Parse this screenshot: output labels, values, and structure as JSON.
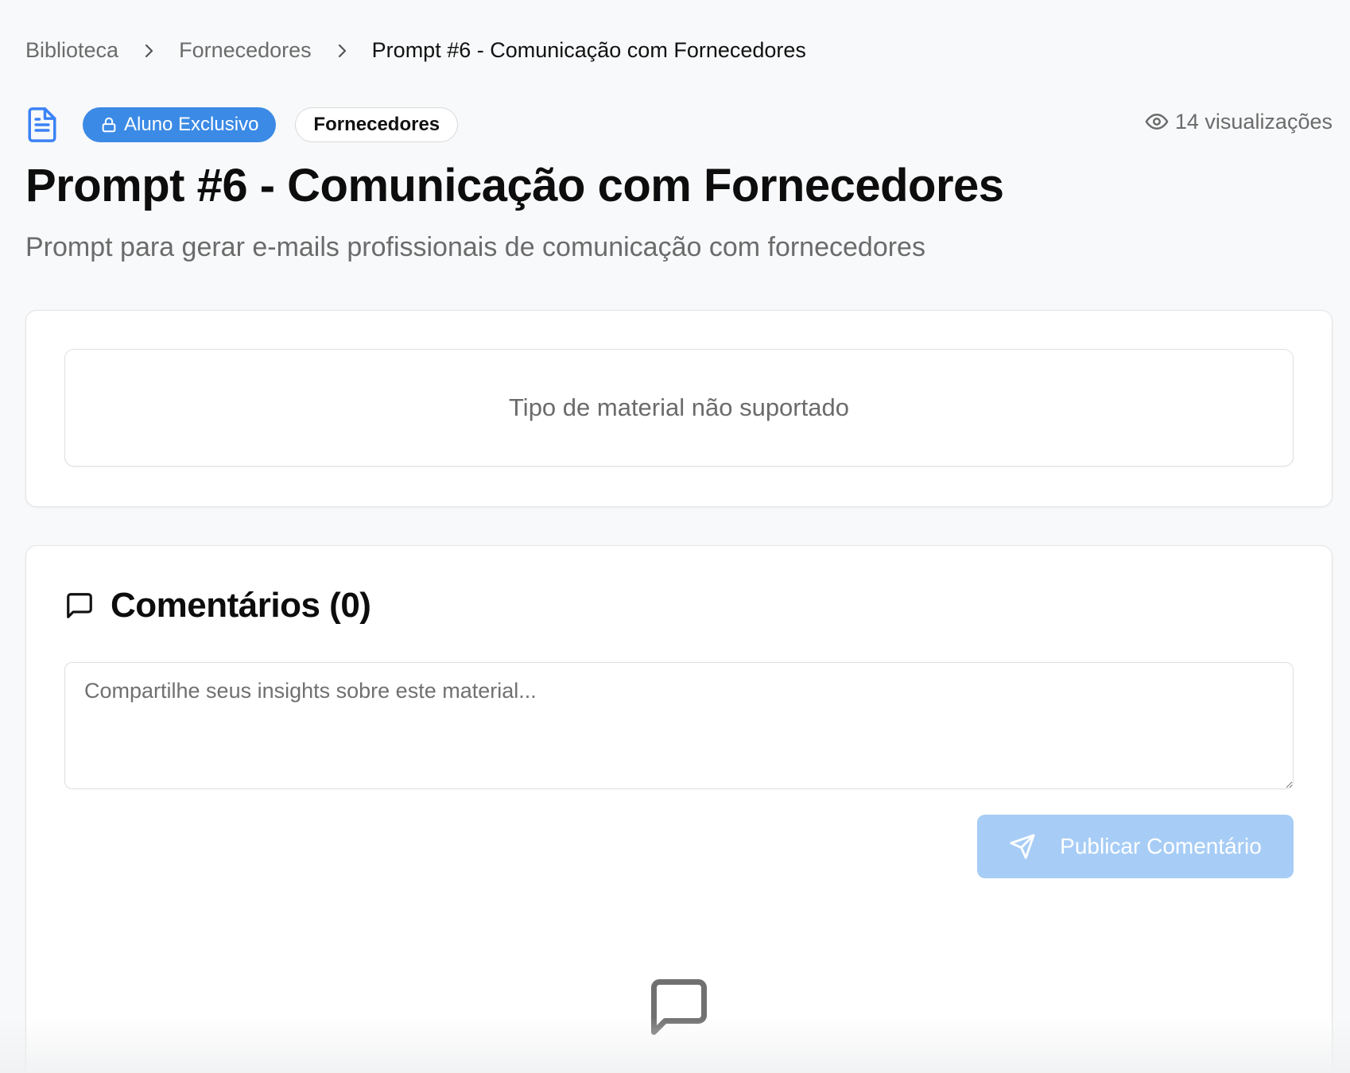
{
  "breadcrumb": {
    "items": [
      "Biblioteca",
      "Fornecedores",
      "Prompt #6 - Comunicação com Fornecedores"
    ]
  },
  "meta": {
    "exclusive_label": "Aluno Exclusivo",
    "category_label": "Fornecedores",
    "views_text": "14 visualizações"
  },
  "header": {
    "title": "Prompt #6 - Comunicação com Fornecedores",
    "subtitle": "Prompt para gerar e-mails profissionais de comunicação com fornecedores"
  },
  "material": {
    "message": "Tipo de material não suportado"
  },
  "comments": {
    "title": "Comentários (0)",
    "input_placeholder": "Compartilhe seus insights sobre este material...",
    "input_value": "",
    "publish_label": "Publicar Comentário"
  },
  "icons": {
    "document": "document-icon",
    "lock": "lock-icon",
    "eye": "eye-icon",
    "chevron": "chevron-right-icon",
    "comment": "message-square-icon",
    "send": "send-icon"
  },
  "colors": {
    "accent": "#3b8ae6",
    "accent_disabled": "#a7cdf6",
    "doc_icon": "#3b82f6",
    "muted_text": "#6b6b6b",
    "background": "#f8f9fa"
  }
}
